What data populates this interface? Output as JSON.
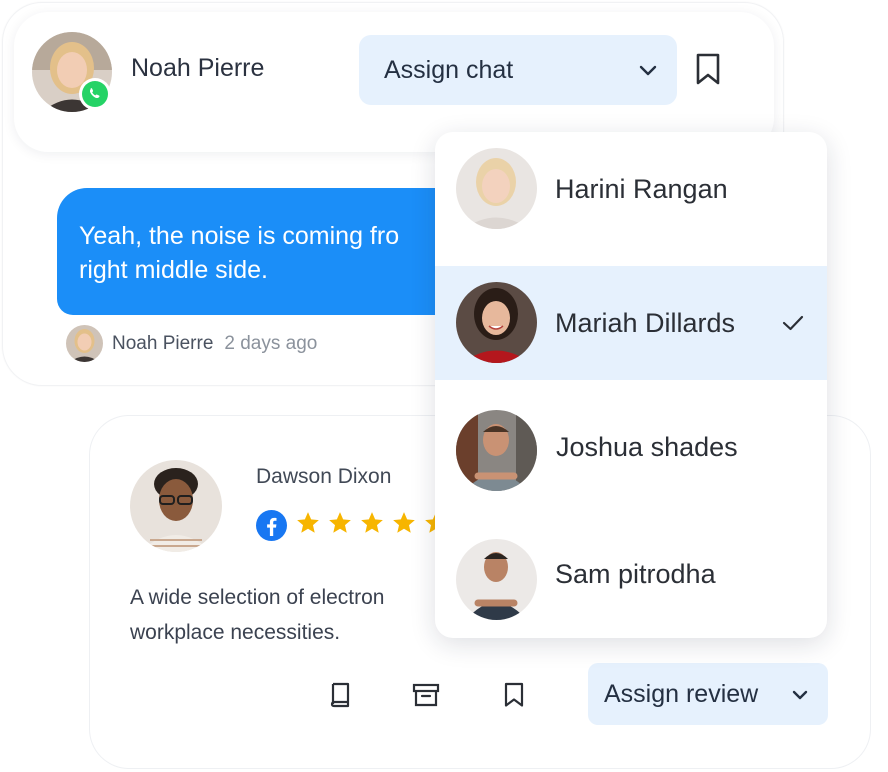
{
  "chat": {
    "contact_name": "Noah Pierre",
    "assign_label": "Assign chat",
    "message_line1": "Yeah, the noise is coming fro",
    "message_line2": "right middle side.",
    "sender_name": "Noah Pierre",
    "sent_time": "2 days ago"
  },
  "review": {
    "reviewer_name": "Dawson Dixon",
    "rating": 5,
    "text_line1": "A wide selection of electron",
    "text_line2": "workplace necessities.",
    "assign_label": "Assign review"
  },
  "assignees": [
    {
      "name": "Harini Rangan",
      "selected": false
    },
    {
      "name": "Mariah Dillards",
      "selected": true
    },
    {
      "name": "Joshua shades",
      "selected": false
    },
    {
      "name": "Sam pitrodha",
      "selected": false
    }
  ],
  "colors": {
    "accent": "#1b8ef8",
    "selected_bg": "#e6f1fd",
    "star": "#f7b500",
    "whatsapp": "#25d366",
    "facebook": "#1877f2"
  },
  "icons": [
    "whatsapp-icon",
    "chevron-down-icon",
    "bookmark-icon",
    "facebook-icon",
    "star-icon",
    "book-icon",
    "archive-icon",
    "check-icon"
  ]
}
